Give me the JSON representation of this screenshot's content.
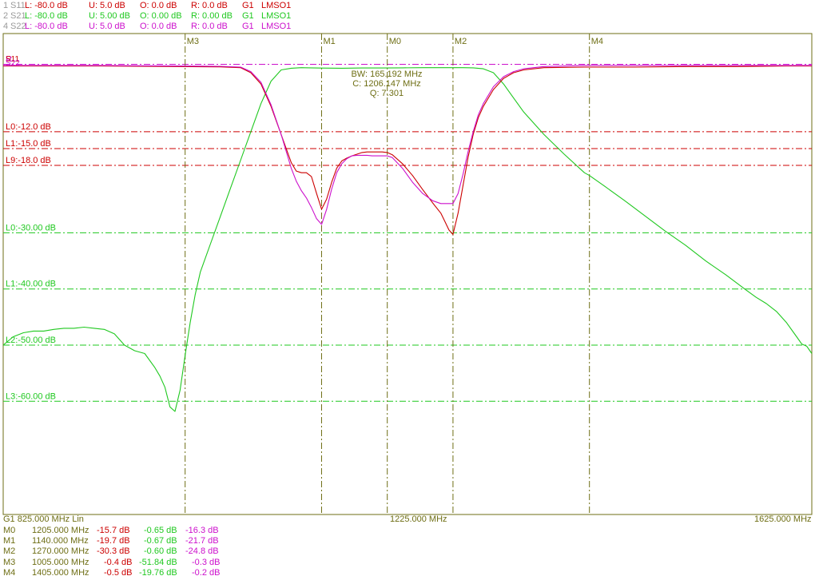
{
  "colors": {
    "s11": "#cc0000",
    "s21": "#1fc81f",
    "s22": "#cc10cc",
    "marker": "#6e6e14",
    "grid_olive": "#6e6e14",
    "header_gray": "#9a9a9a"
  },
  "header": [
    {
      "id": "1",
      "param": "S11",
      "l": "L: -80.0 dB",
      "u": "U:  5.0 dB",
      "o": "O:  0.0 dB",
      "r": "R:  0.0 dB",
      "g": "G1",
      "cal": "LMSO1"
    },
    {
      "id": "2",
      "param": "S21",
      "l": "L: -80.0 dB",
      "u": "U:  5.00 dB",
      "o": "O:  0.00 dB",
      "r": "R:  0.00 dB",
      "g": "G1",
      "cal": "LMSO1"
    },
    {
      "id": "4",
      "param": "S22",
      "l": "L: -80.0 dB",
      "u": "U:  5.0 dB",
      "o": "O:  0.0 dB",
      "r": "R:  0.0 dB",
      "g": "G1",
      "cal": "LMSO1"
    }
  ],
  "footer": {
    "label": "G1   825.000 MHz   Lin",
    "center": "1225.000 MHz",
    "stop": "1625.000 MHz"
  },
  "markers_table": [
    {
      "name": "M0",
      "freq": "1205.000 MHz",
      "s11": "-15.7 dB",
      "s21": "-0.65 dB",
      "s22": "-16.3 dB"
    },
    {
      "name": "M1",
      "freq": "1140.000 MHz",
      "s11": "-19.7 dB",
      "s21": "-0.67 dB",
      "s22": "-21.7 dB"
    },
    {
      "name": "M2",
      "freq": "1270.000 MHz",
      "s11": "-30.3 dB",
      "s21": "-0.60 dB",
      "s22": "-24.8 dB"
    },
    {
      "name": "M3",
      "freq": "1005.000 MHz",
      "s11": "-0.4 dB",
      "s21": "-51.84 dB",
      "s22": "-0.3 dB"
    },
    {
      "name": "M4",
      "freq": "1405.000 MHz",
      "s11": "-0.5 dB",
      "s21": "-19.76 dB",
      "s22": "-0.2 dB"
    }
  ],
  "chart_data": {
    "type": "line",
    "x_unit": "MHz",
    "xlim": [
      825,
      1625
    ],
    "ylim": [
      -80,
      5
    ],
    "grid": true,
    "legend": "top-left",
    "marker_lines": [
      {
        "name": "M3",
        "x": 1005
      },
      {
        "name": "M1",
        "x": 1140
      },
      {
        "name": "M0",
        "x": 1205
      },
      {
        "name": "M2",
        "x": 1270
      },
      {
        "name": "M4",
        "x": 1405
      }
    ],
    "ref_lines": [
      {
        "label": "R",
        "y": 0,
        "color": "#cc10cc",
        "style": "dashdot"
      },
      {
        "label": "L0:-12.0 dB",
        "y": -12,
        "color": "#cc0000",
        "style": "dashdot"
      },
      {
        "label": "L1:-15.0 dB",
        "y": -15,
        "color": "#cc0000",
        "style": "dashdot"
      },
      {
        "label": "L9:-18.0 dB",
        "y": -18,
        "color": "#cc0000",
        "style": "dashdot"
      },
      {
        "label": "L0:-30.00 dB",
        "y": -30,
        "color": "#1fc81f",
        "style": "dashdot"
      },
      {
        "label": "L1:-40.00 dB",
        "y": -40,
        "color": "#1fc81f",
        "style": "dashdot"
      },
      {
        "label": "L2:-50.00 dB",
        "y": -50,
        "color": "#1fc81f",
        "style": "dashdot"
      },
      {
        "label": "L3:-60.00 dB",
        "y": -60,
        "color": "#1fc81f",
        "style": "dashdot"
      }
    ],
    "trace_labels": [
      "S11",
      "S22"
    ],
    "annotation": [
      "BW: 165.192 MHz",
      "C: 1206.147 MHz",
      "Q: 7.301"
    ],
    "series": [
      {
        "name": "S21",
        "color": "#1fc81f",
        "x": [
          825,
          835,
          845,
          855,
          865,
          875,
          885,
          895,
          905,
          915,
          925,
          935,
          945,
          955,
          965,
          975,
          980,
          985,
          990,
          995,
          1000,
          1005,
          1010,
          1015,
          1020,
          1030,
          1040,
          1050,
          1060,
          1070,
          1080,
          1090,
          1100,
          1110,
          1120,
          1140,
          1160,
          1180,
          1200,
          1220,
          1240,
          1260,
          1280,
          1290,
          1300,
          1310,
          1320,
          1330,
          1340,
          1360,
          1380,
          1400,
          1405,
          1420,
          1440,
          1460,
          1480,
          1500,
          1520,
          1540,
          1560,
          1570,
          1580,
          1590,
          1600,
          1610,
          1615,
          1620,
          1625
        ],
        "y": [
          -50,
          -48.5,
          -47.8,
          -47.5,
          -47.5,
          -47.2,
          -47.0,
          -47.0,
          -46.8,
          -47.0,
          -47.2,
          -48.0,
          -50.0,
          -51.0,
          -51.5,
          -54,
          -55.5,
          -57.5,
          -61,
          -61.8,
          -58,
          -51.8,
          -46,
          -41,
          -37,
          -32,
          -27,
          -22,
          -17,
          -12,
          -7,
          -3,
          -1,
          -0.7,
          -0.6,
          -0.67,
          -0.7,
          -0.66,
          -0.65,
          -0.62,
          -0.6,
          -0.6,
          -0.6,
          -0.62,
          -0.8,
          -1.5,
          -3.5,
          -6,
          -8.5,
          -12.5,
          -16,
          -19.3,
          -19.8,
          -21.7,
          -24.3,
          -27,
          -29.7,
          -32.2,
          -35,
          -37.5,
          -40.2,
          -41.5,
          -42.6,
          -44,
          -46,
          -48.5,
          -49.8,
          -50.2,
          -51.5
        ]
      },
      {
        "name": "S11",
        "color": "#cc0000",
        "x": [
          825,
          880,
          920,
          960,
          1000,
          1040,
          1060,
          1070,
          1080,
          1090,
          1100,
          1110,
          1115,
          1120,
          1125,
          1130,
          1135,
          1140,
          1145,
          1150,
          1155,
          1160,
          1165,
          1170,
          1175,
          1180,
          1185,
          1190,
          1195,
          1200,
          1205,
          1210,
          1220,
          1230,
          1240,
          1250,
          1258,
          1262,
          1266,
          1270,
          1275,
          1280,
          1285,
          1290,
          1295,
          1300,
          1310,
          1320,
          1330,
          1340,
          1360,
          1400,
          1450,
          1500,
          1550,
          1600,
          1625
        ],
        "y": [
          -0.3,
          -0.3,
          -0.3,
          -0.35,
          -0.4,
          -0.45,
          -0.6,
          -1.5,
          -3.5,
          -7.5,
          -12.5,
          -17.5,
          -19,
          -19.3,
          -19.3,
          -20,
          -23,
          -25.8,
          -24,
          -21,
          -18.5,
          -17.2,
          -16.7,
          -16.3,
          -16,
          -15.7,
          -15.6,
          -15.6,
          -15.6,
          -15.6,
          -15.7,
          -16.1,
          -17.7,
          -19.8,
          -22.3,
          -24.7,
          -26.5,
          -28,
          -29.5,
          -30.3,
          -26.5,
          -21.5,
          -16.5,
          -12.5,
          -9.5,
          -7.5,
          -4.5,
          -2.5,
          -1.5,
          -1,
          -0.6,
          -0.5,
          -0.5,
          -0.4,
          -0.4,
          -0.3,
          -0.3
        ]
      },
      {
        "name": "S22",
        "color": "#cc10cc",
        "x": [
          825,
          880,
          920,
          960,
          1000,
          1040,
          1060,
          1070,
          1080,
          1090,
          1100,
          1110,
          1115,
          1120,
          1125,
          1130,
          1135,
          1140,
          1145,
          1150,
          1155,
          1160,
          1165,
          1170,
          1175,
          1180,
          1185,
          1190,
          1195,
          1200,
          1205,
          1210,
          1220,
          1230,
          1240,
          1250,
          1258,
          1262,
          1266,
          1270,
          1275,
          1280,
          1285,
          1290,
          1295,
          1300,
          1310,
          1320,
          1330,
          1340,
          1360,
          1400,
          1450,
          1500,
          1550,
          1600,
          1625
        ],
        "y": [
          -0.2,
          -0.2,
          -0.2,
          -0.25,
          -0.3,
          -0.35,
          -0.5,
          -1.3,
          -3.2,
          -7.2,
          -12.5,
          -18.5,
          -20.8,
          -22.5,
          -23.8,
          -25.5,
          -27.5,
          -28.5,
          -25.8,
          -22.2,
          -19.3,
          -17.7,
          -16.8,
          -16.3,
          -16.2,
          -16.2,
          -16.2,
          -16.3,
          -16.3,
          -16.3,
          -16.3,
          -16.6,
          -18.5,
          -21,
          -23,
          -24.3,
          -24.8,
          -24.8,
          -24.8,
          -24.8,
          -23,
          -19.5,
          -15.5,
          -12,
          -9,
          -7,
          -4,
          -2.2,
          -1.3,
          -0.8,
          -0.4,
          -0.2,
          -0.2,
          -0.2,
          -0.2,
          -0.2,
          -0.2
        ]
      }
    ]
  }
}
